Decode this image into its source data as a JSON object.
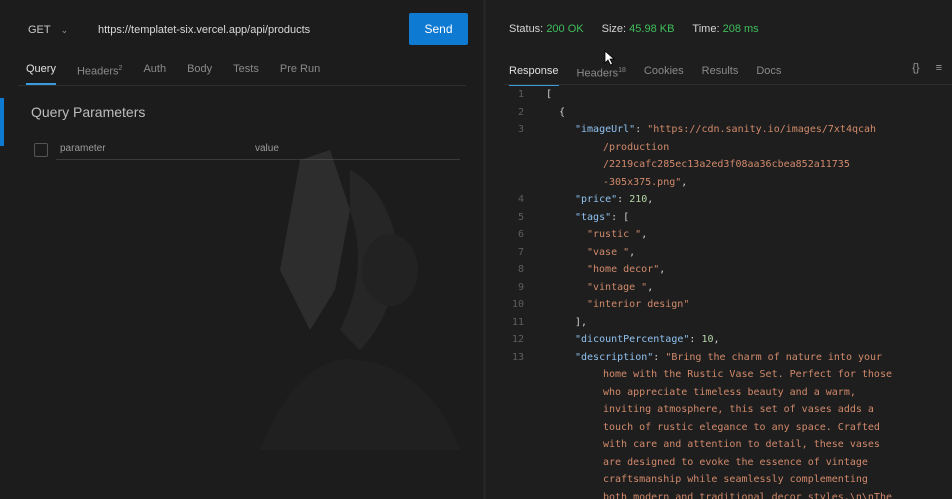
{
  "request": {
    "method": "GET",
    "url": "https://templatet-six.vercel.app/api/products",
    "send_label": "Send"
  },
  "left_tabs": [
    "Query",
    "Headers",
    "Auth",
    "Body",
    "Tests",
    "Pre Run"
  ],
  "headers_count": "2",
  "query_params": {
    "title": "Query Parameters",
    "param_placeholder": "parameter",
    "value_placeholder": "value"
  },
  "status": {
    "status_label": "Status:",
    "status_value": "200 OK",
    "size_label": "Size:",
    "size_value": "45.98 KB",
    "time_label": "Time:",
    "time_value": "208 ms"
  },
  "right_tabs": [
    "Response",
    "Headers",
    "Cookies",
    "Results",
    "Docs"
  ],
  "response_headers_count": "18",
  "right_icons": [
    "{}",
    "≡"
  ],
  "response": {
    "line_numbers": [
      "1",
      "2",
      "3",
      "",
      "",
      "",
      "4",
      "5",
      "6",
      "7",
      "8",
      "9",
      "10",
      "11",
      "12",
      "13",
      "",
      "",
      "",
      "",
      "",
      "",
      "",
      ""
    ],
    "open_bracket": "[",
    "open_brace": "{",
    "image_key": "\"imageUrl\"",
    "image_val_1": "\"https://cdn.sanity.io/images/7xt4qcah",
    "image_val_2": "/production",
    "image_val_3": "/2219cafc285ec13a2ed3f08aa36cbea852a11735",
    "image_val_4": "-305x375.png\"",
    "price_key": "\"price\"",
    "price_val": "210",
    "tags_key": "\"tags\"",
    "tags": [
      "\"rustic \"",
      "\"vase \"",
      "\"home decor\"",
      "\"vintage \"",
      "\"interior design\""
    ],
    "close_arr": "],",
    "discount_key": "\"dicountPercentage\"",
    "discount_val": "10",
    "desc_key": "\"description\"",
    "desc_lines": [
      "\"Bring the charm of nature into your",
      "home with the Rustic Vase Set. Perfect for those",
      "who appreciate timeless beauty and a warm,",
      "inviting atmosphere, this set of vases adds a",
      "touch of rustic elegance to any space. Crafted",
      "with care and attention to detail, these vases",
      "are designed to evoke the essence of vintage",
      "craftsmanship while seamlessly complementing",
      "both modern and traditional decor styles.\\n\\nThe"
    ]
  }
}
